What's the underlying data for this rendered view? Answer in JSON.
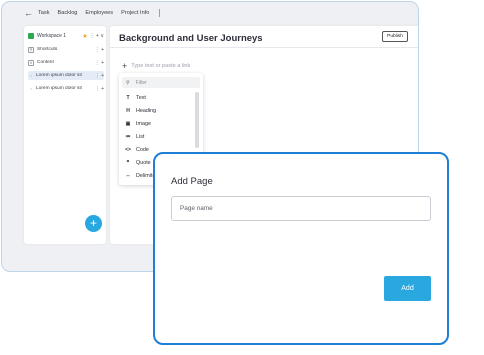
{
  "topbar": {
    "crumbs": [
      "Task",
      "Backlog",
      "Employees",
      "Project Info"
    ]
  },
  "sidebar": {
    "workspace": "Workspace 1",
    "workspace_tools": "⋮ + ∨",
    "items": [
      {
        "label": "Shortcuts",
        "tools": "⋮ +"
      },
      {
        "label": "Content",
        "tools": "⋮ +"
      },
      {
        "label": "Lorem ipsum dolor sit",
        "tools": "⋮ +"
      },
      {
        "label": "Lorem ipsum dolor sit",
        "tools": "⋮ +"
      }
    ],
    "fab": "+"
  },
  "document": {
    "title": "Background and User Journeys",
    "publish_label": "Publish",
    "type_prompt": "Type text or paste a link",
    "menu": {
      "filter_placeholder": "Filter",
      "items": [
        {
          "icon": "T",
          "label": "Text"
        },
        {
          "icon": "H",
          "label": "Heading"
        },
        {
          "icon": "▣",
          "label": "Image"
        },
        {
          "icon": "≔",
          "label": "List"
        },
        {
          "icon": "<>",
          "label": "Code"
        },
        {
          "icon": "❞",
          "label": "Quote"
        },
        {
          "icon": "--",
          "label": "Delimiter"
        }
      ]
    }
  },
  "dialog": {
    "title": "Add Page",
    "input_placeholder": "Page name",
    "add_label": "Add"
  },
  "colors": {
    "accent": "#29a8e0",
    "dialog_border": "#1f7fd4",
    "workspace_logo": "#2fa84f",
    "star": "#f0a020"
  }
}
